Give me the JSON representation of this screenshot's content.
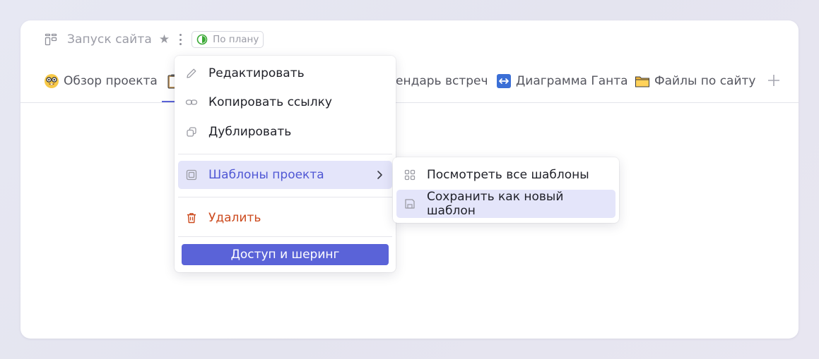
{
  "project": {
    "title": "Запуск сайта",
    "status": "По плану",
    "status_color": "#3aa935"
  },
  "tabs": [
    {
      "icon": "nerd-face-emoji-icon",
      "label": "Обзор проекта"
    },
    {
      "icon": "clipboard-emoji-icon",
      "label": ""
    },
    {
      "icon": "calendar-icon",
      "label": "ендарь встреч"
    },
    {
      "icon": "left-right-arrow-emoji-icon",
      "label": "Диаграмма Ганта"
    },
    {
      "icon": "folder-emoji-icon",
      "label": "Файлы по сайту"
    }
  ],
  "menu": {
    "edit": "Редактировать",
    "copy_link": "Копировать ссылку",
    "duplicate": "Дублировать",
    "templates": "Шаблоны проекта",
    "delete": "Удалить",
    "share": "Доступ и шеринг"
  },
  "submenu": {
    "view_all": "Посмотреть все шаблоны",
    "save_new": "Сохранить как новый шаблон"
  },
  "colors": {
    "accent": "#5a63d8",
    "danger": "#cc4a1e",
    "highlight": "#e4e5fa"
  }
}
